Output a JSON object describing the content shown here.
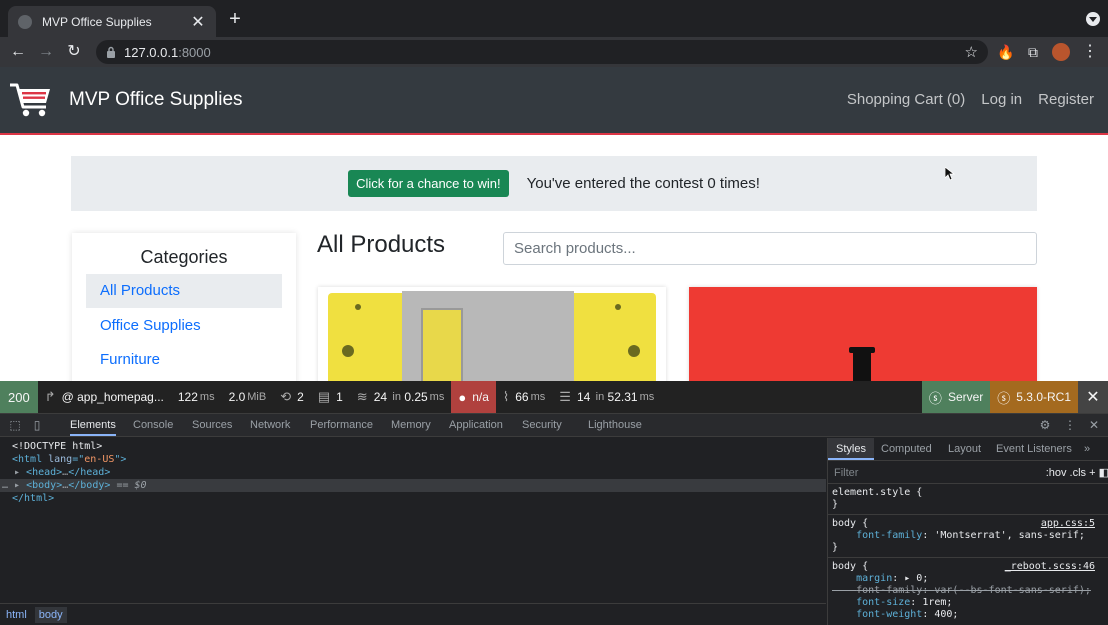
{
  "browser": {
    "tab_title": "MVP Office Supplies",
    "tab_close": "✕",
    "new_tab": "+",
    "url_host": "127.0.0.1",
    "url_port": ":8000"
  },
  "site": {
    "brand": "MVP Office Supplies",
    "nav": [
      "Shopping Cart (0)",
      "Log in",
      "Register"
    ],
    "contest_button": "Click for a chance to win!",
    "contest_text": "You've entered the contest 0 times!",
    "categories_title": "Categories",
    "categories": [
      "All Products",
      "Office Supplies",
      "Furniture"
    ],
    "products_title": "All Products",
    "search_placeholder": "Search products..."
  },
  "profiler": {
    "status": "200",
    "route": "@ app_homepag...",
    "time_value": "122",
    "time_unit": "ms",
    "memory_value": "2.0",
    "memory_unit": "MiB",
    "requests": "2",
    "forms": "1",
    "cache_count": "24",
    "cache_in": "in",
    "cache_time": "0.25",
    "cache_unit": "ms",
    "user": "n/a",
    "twig_time": "66",
    "twig_unit": "ms",
    "db_count": "14",
    "db_in": "in",
    "db_time": "52.31",
    "db_unit": "ms",
    "server": "Server",
    "version": "5.3.0-RC1"
  },
  "devtools": {
    "tabs": [
      "Elements",
      "Console",
      "Sources",
      "Network",
      "Performance",
      "Memory",
      "Application",
      "Security",
      "Lighthouse"
    ],
    "breadcrumb": [
      "html",
      "body"
    ],
    "styles_tabs": [
      "Styles",
      "Computed",
      "Layout",
      "Event Listeners"
    ],
    "filter_placeholder": "Filter",
    "filter_tools": ":hov  .cls  +",
    "dom": {
      "doctype": "<!DOCTYPE html>",
      "html_lang": "en-US",
      "ellipsis": "…",
      "selected_marker": "== $0"
    },
    "rules": [
      {
        "selector": "element.style {",
        "close": "}"
      },
      {
        "selector": "body {",
        "source": "app.css:5",
        "prop": "font-family",
        "value": "'Montserrat', sans-serif;",
        "close": "}"
      },
      {
        "selector": "body {",
        "source": "_reboot.scss:46",
        "props": [
          {
            "name": "margin",
            "value": "▸ 0;"
          },
          {
            "name": "font-family",
            "value": "var(--bs-font-sans-serif);",
            "struck": true
          },
          {
            "name": "font-size",
            "value": "1rem;"
          },
          {
            "name": "font-weight",
            "value": "400;"
          }
        ]
      }
    ]
  },
  "colors": {
    "nav_bg": "#343a40",
    "accent_red": "#dc3545",
    "success": "#198754",
    "link": "#0d6efd"
  }
}
